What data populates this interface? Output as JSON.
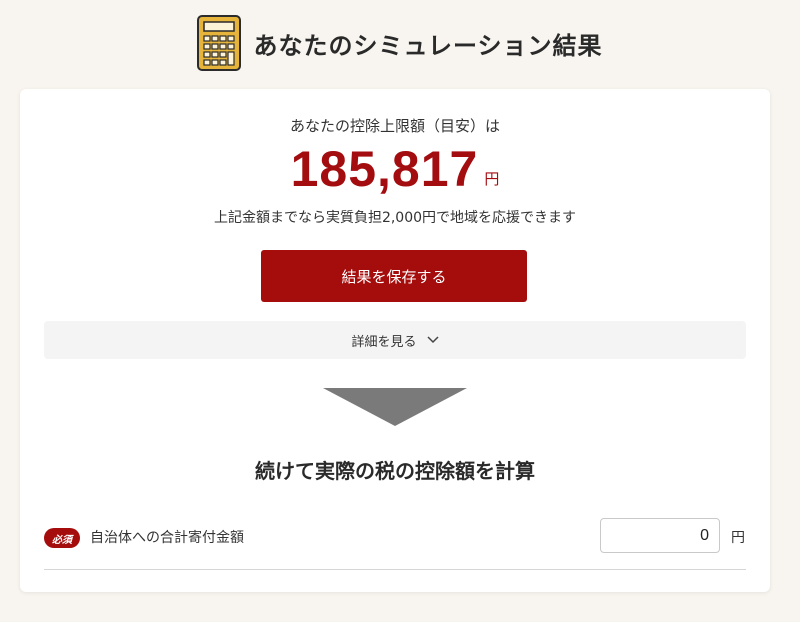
{
  "header": {
    "title": "あなたのシミュレーション結果",
    "icon": "calculator-icon"
  },
  "result": {
    "limit_label": "あなたの控除上限額（目安）は",
    "amount": "185,817",
    "unit": "円",
    "note": "上記金額までなら実質負担2,000円で地域を応援できます",
    "save_button_label": "結果を保存する",
    "details_label": "詳細を見る"
  },
  "calc_section": {
    "title": "続けて実際の税の控除額を計算",
    "required_badge": "必須",
    "field_label": "自治体への合計寄付金額",
    "field_value": "0",
    "field_unit": "円"
  },
  "colors": {
    "accent": "#a50c0c",
    "amount": "#a30d10",
    "background": "#f8f4ef",
    "details_bg": "#f4f4f4"
  }
}
